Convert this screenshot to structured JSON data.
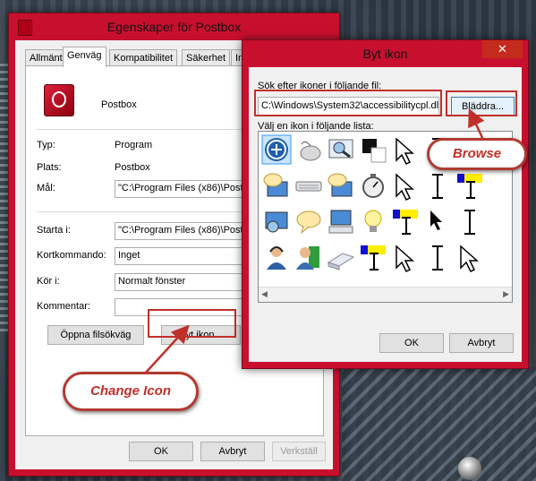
{
  "props_window": {
    "title": "Egenskaper för Postbox",
    "tabs": [
      "Allmänt",
      "Genväg",
      "Kompatibilitet",
      "Säkerhet",
      "Inf"
    ],
    "app_name": "Postbox",
    "rows": {
      "typ_label": "Typ:",
      "typ_value": "Program",
      "plats_label": "Plats:",
      "plats_value": "Postbox",
      "mal_label": "Mål:",
      "mal_value": "\"C:\\Program Files (x86)\\Postbox",
      "starta_label": "Starta i:",
      "starta_value": "\"C:\\Program Files (x86)\\Postbox",
      "kort_label": "Kortkommando:",
      "kort_value": "Inget",
      "kor_label": "Kör i:",
      "kor_value": "Normalt fönster",
      "kommentar_label": "Kommentar:",
      "kommentar_value": ""
    },
    "buttons": {
      "open_location": "Öppna filsökväg",
      "change_icon": "Byt ikon...",
      "ok": "OK",
      "cancel": "Avbryt",
      "apply": "Verkställ"
    }
  },
  "icon_dialog": {
    "title": "Byt ikon",
    "close": "✕",
    "search_label": "Sök efter ikoner i följande fil:",
    "path_value": "C:\\Windows\\System32\\accessibilitycpl.dll",
    "browse": "Bläddra...",
    "list_label": "Välj en ikon i följande lista:",
    "ok": "OK",
    "cancel": "Avbryt",
    "icons": [
      [
        "accessibility-icon",
        "mouse-icon",
        "magnifier-icon",
        "contrast-icon",
        "arrow-cursor-icon",
        "text-cursor-icon",
        "cursor-icon"
      ],
      [
        "monitor-bubble-icon",
        "keyboard-icon",
        "monitor-bubble-icon",
        "stopwatch-icon",
        "arrow-cursor-icon",
        "text-cursor-icon",
        "text-cursor-highlight-icon"
      ],
      [
        "monitor-magnifier-icon",
        "speech-bubble-icon",
        "monitor-keyboard-icon",
        "lightbulb-icon",
        "text-cursor-highlight-icon",
        "cursor-icon",
        "text-cursor-icon"
      ],
      [
        "user-headset-icon",
        "users-icon",
        "keys-icon",
        "text-cursor-highlight-icon",
        "arrow-cursor-icon",
        "text-cursor-icon",
        "arrow-cursor-icon"
      ]
    ]
  },
  "callouts": {
    "browse": "Browse",
    "change_icon": "Change Icon"
  },
  "colors": {
    "window_frame": "#c8102e",
    "close_button": "#c42b1c",
    "callout_border": "#b23a32",
    "selection": "#cce4f7"
  }
}
